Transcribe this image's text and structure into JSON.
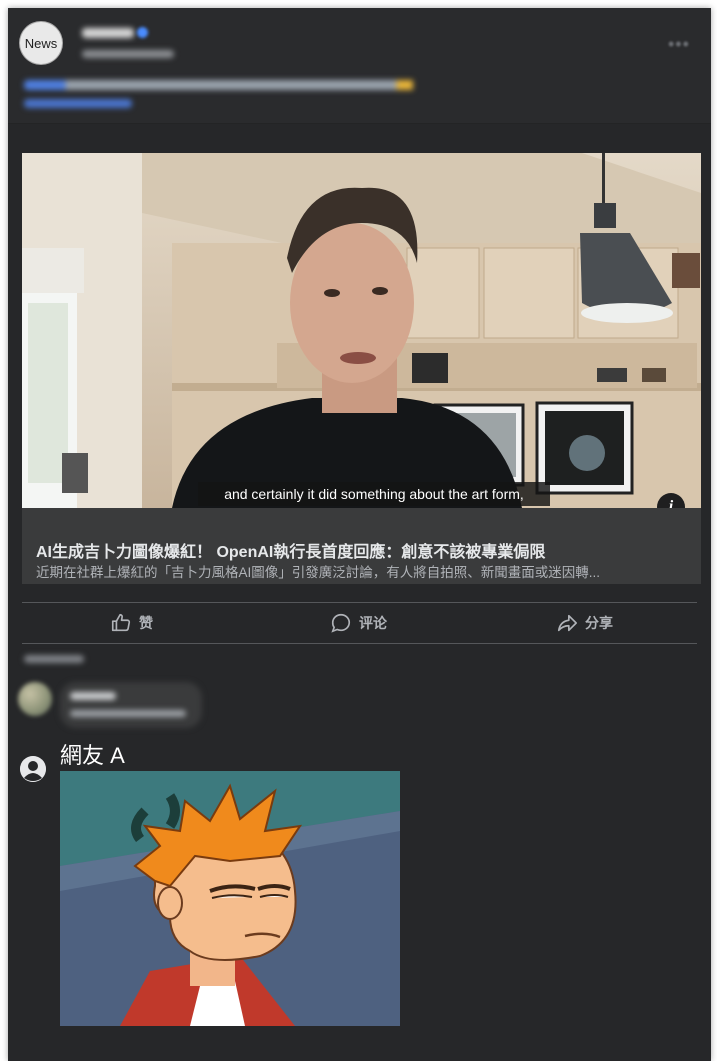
{
  "post": {
    "avatar_text": "News"
  },
  "video": {
    "subtitle": "and certainly it did something about the art form,",
    "info_icon": "info-icon"
  },
  "link": {
    "title": "AI生成吉卜力圖像爆紅！ OpenAI執行長首度回應：創意不該被專業侷限",
    "description": "近期在社群上爆紅的「吉卜力風格AI圖像」引發廣泛討論，有人將自拍照、新聞畫面或迷因轉..."
  },
  "actions": [
    {
      "label": "赞",
      "icon": "thumbs-up-icon"
    },
    {
      "label": "评论",
      "icon": "comment-icon"
    },
    {
      "label": "分享",
      "icon": "share-icon"
    }
  ],
  "comment_a": {
    "name": "網友 A",
    "avatar_icon": "user-icon"
  },
  "colors": {
    "card_bg": "#262729",
    "text_muted": "#b0b3b8",
    "link_box": "#3a3b3c"
  }
}
